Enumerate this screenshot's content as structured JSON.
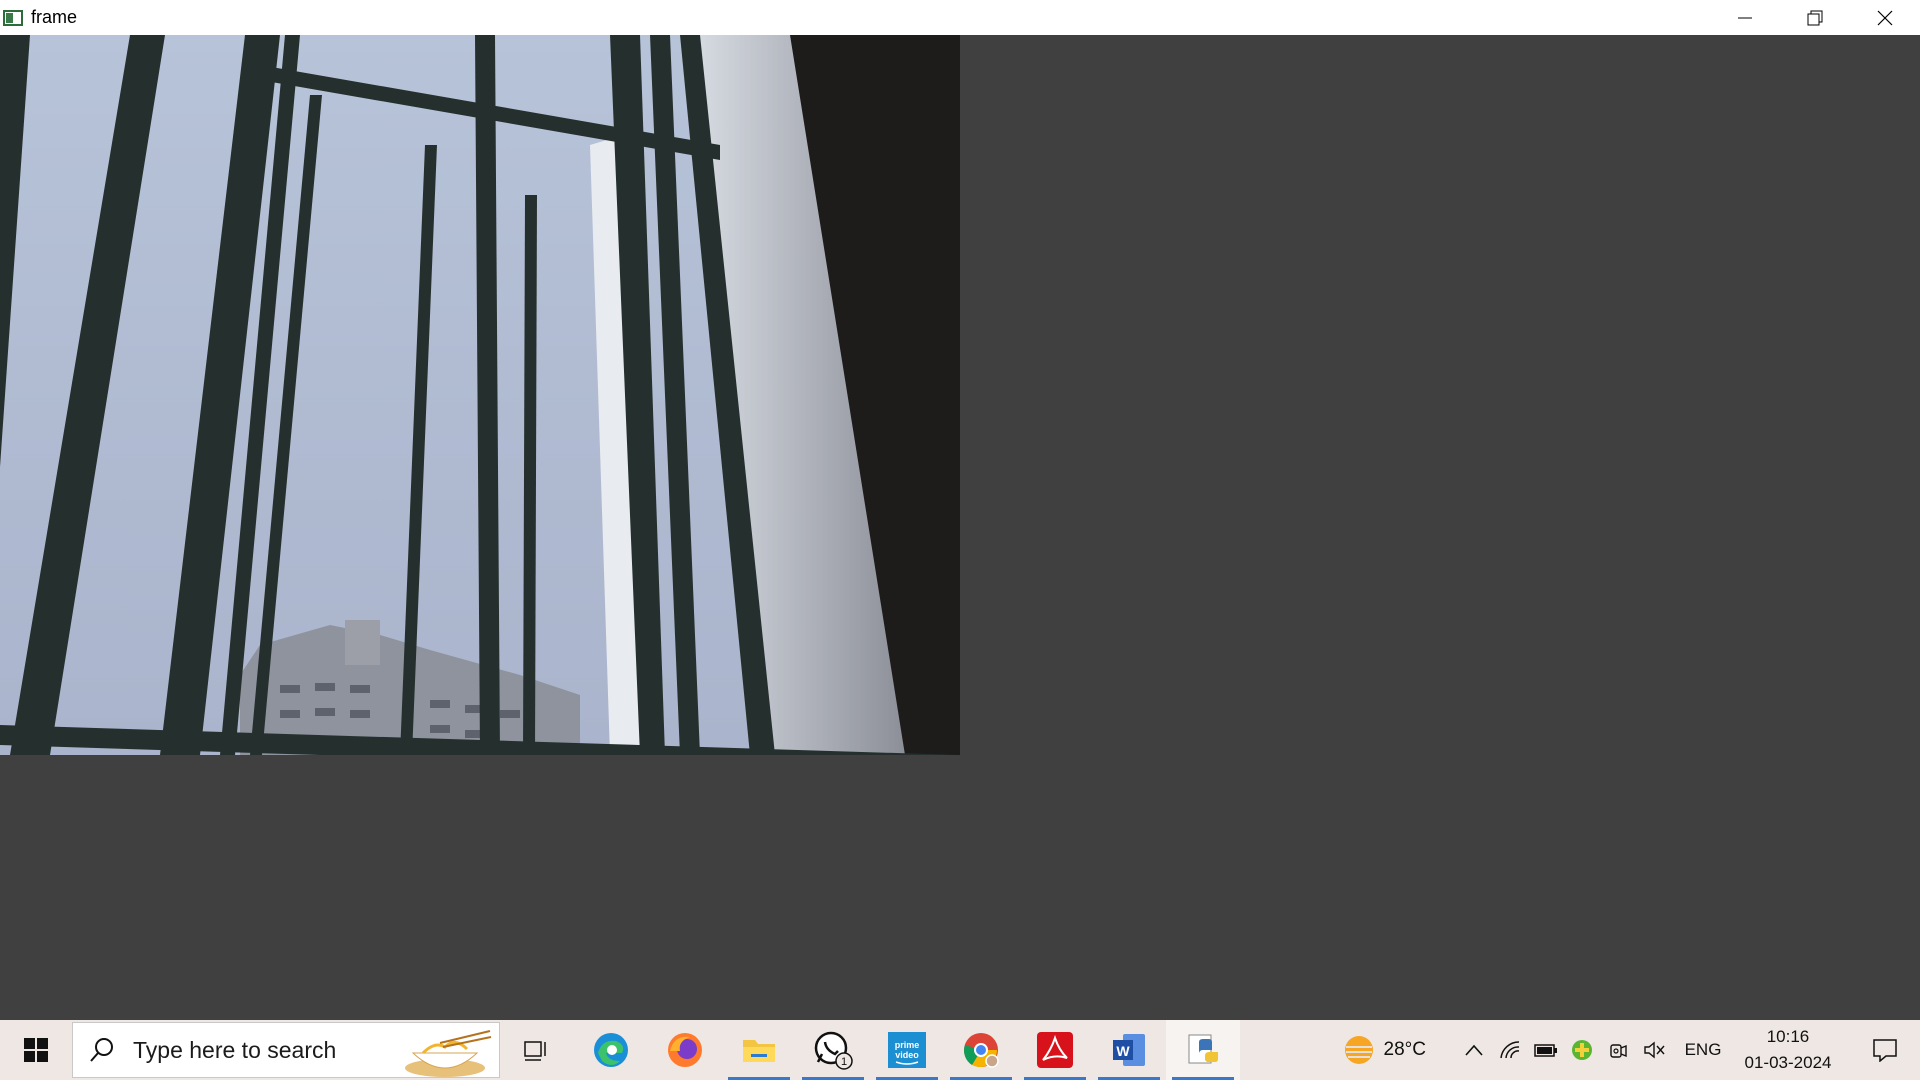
{
  "window": {
    "title": "frame",
    "controls": [
      "minimize",
      "restore",
      "close"
    ]
  },
  "frame": {
    "description_icon": "camera-frame-image"
  },
  "taskbar": {
    "search_placeholder": "Type here to search",
    "apps": [
      {
        "name": "task-view",
        "active": false
      },
      {
        "name": "edge",
        "active": false
      },
      {
        "name": "firefox",
        "active": false
      },
      {
        "name": "file-explorer",
        "active": true
      },
      {
        "name": "whatsapp",
        "active": true,
        "badge": "1"
      },
      {
        "name": "prime-video",
        "active": true,
        "label": "prime video"
      },
      {
        "name": "chrome",
        "active": true
      },
      {
        "name": "acrobat",
        "active": true
      },
      {
        "name": "word",
        "active": true
      },
      {
        "name": "python",
        "active": true
      }
    ],
    "weather": {
      "temp": "28°C"
    },
    "language": "ENG",
    "time": "10:16",
    "date": "01-03-2024"
  },
  "colors": {
    "taskbar_bg": "#eee7e3",
    "window_bg": "#404040",
    "active_indicator": "#3b78c9"
  }
}
